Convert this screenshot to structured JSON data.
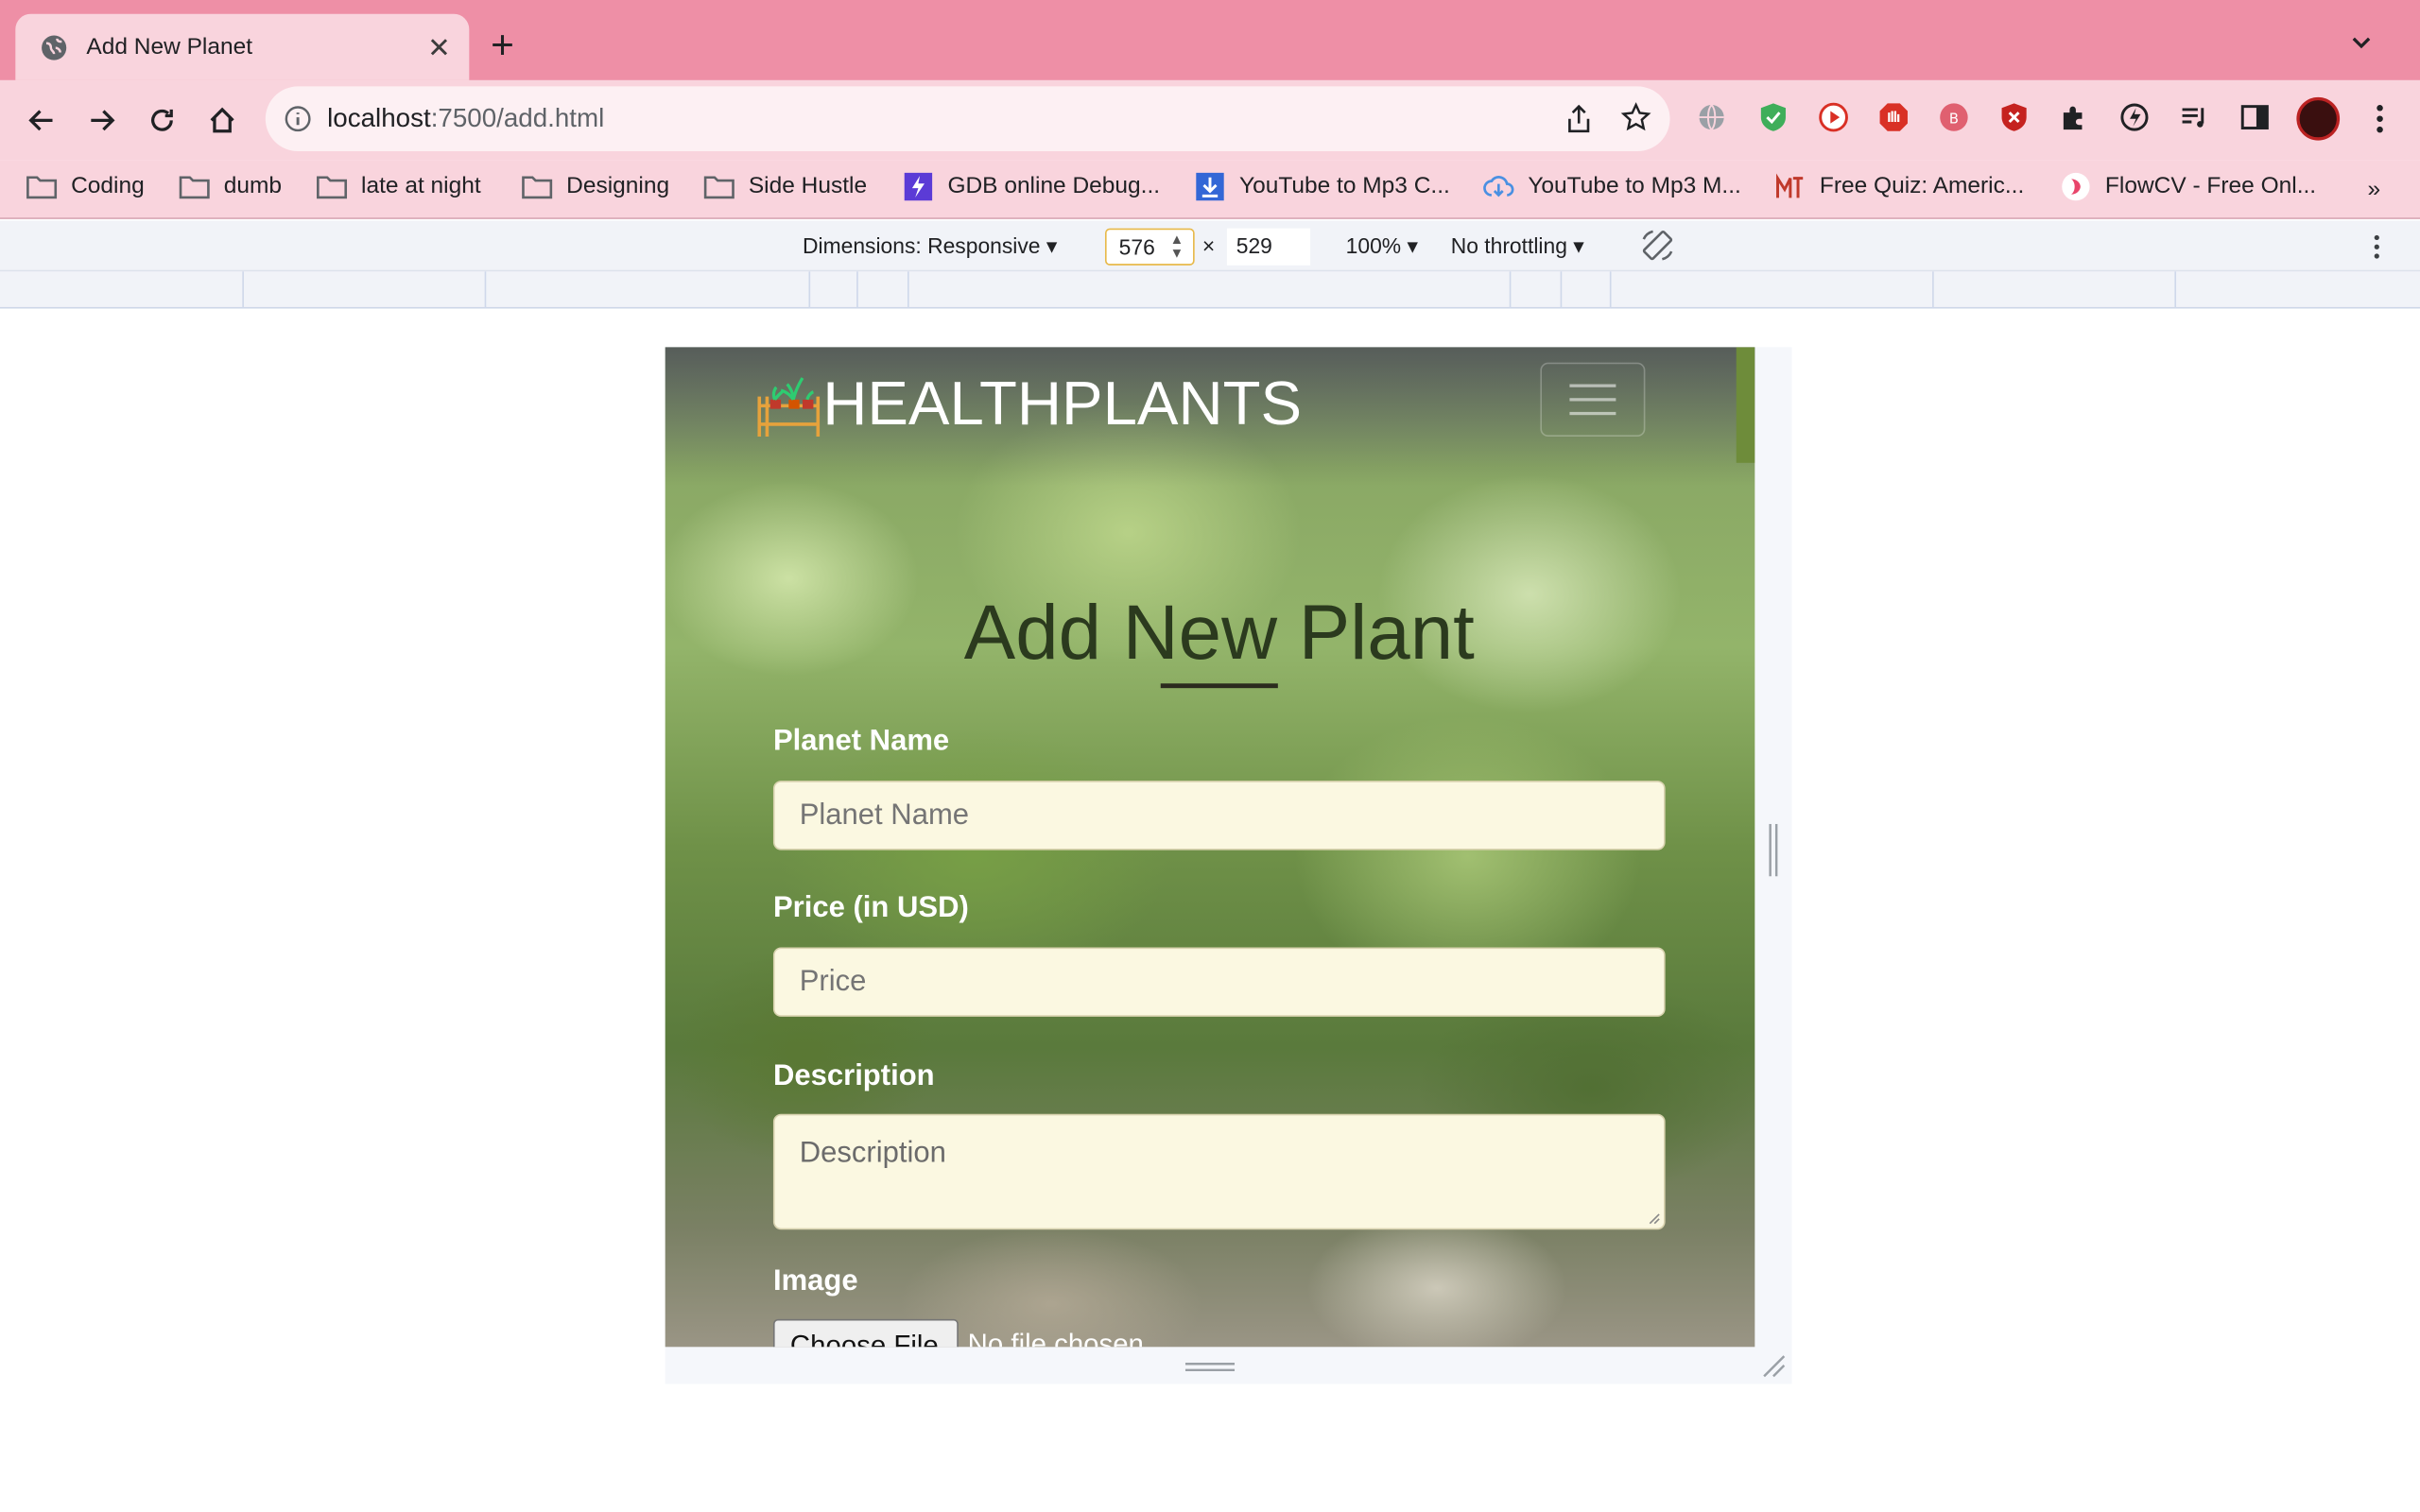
{
  "browser": {
    "tab_title": "Add New Planet",
    "new_tab_symbol": "+",
    "close_symbol": "✕",
    "url_host": "localhost",
    "url_path": ":7500/add.html"
  },
  "bookmarks": [
    {
      "label": "Coding",
      "icon": "folder-icon"
    },
    {
      "label": "dumb",
      "icon": "folder-icon"
    },
    {
      "label": "late at night",
      "icon": "folder-icon"
    },
    {
      "label": "Designing",
      "icon": "folder-icon"
    },
    {
      "label": "Side Hustle",
      "icon": "folder-icon"
    },
    {
      "label": "GDB online Debug...",
      "icon": "gdb-icon"
    },
    {
      "label": "YouTube to Mp3 C...",
      "icon": "download-icon"
    },
    {
      "label": "YouTube to Mp3 M...",
      "icon": "cloud-download-icon"
    },
    {
      "label": "Free Quiz: Americ...",
      "icon": "quiz-icon"
    },
    {
      "label": "FlowCV - Free Onl...",
      "icon": "flowcv-icon"
    }
  ],
  "bookmarks_more": "»",
  "devtools": {
    "dimensions_label": "Dimensions: Responsive",
    "width": "576",
    "times": "×",
    "height": "529",
    "zoom": "100%",
    "throttling": "No throttling"
  },
  "page": {
    "brand": "HEALTHPLANTS",
    "heading": "Add New Plant",
    "fields": {
      "name_label": "Planet Name",
      "name_placeholder": "Planet Name",
      "price_label": "Price (in USD)",
      "price_placeholder": "Price",
      "description_label": "Description",
      "description_placeholder": "Description",
      "image_label": "Image",
      "file_button": "Choose File",
      "file_status": "No file chosen"
    }
  },
  "colors": {
    "tabstrip": "#ee8fa6",
    "toolbar": "#f9d4dd",
    "field_bg": "#fbf8e1",
    "heading": "#2b3a1e"
  }
}
